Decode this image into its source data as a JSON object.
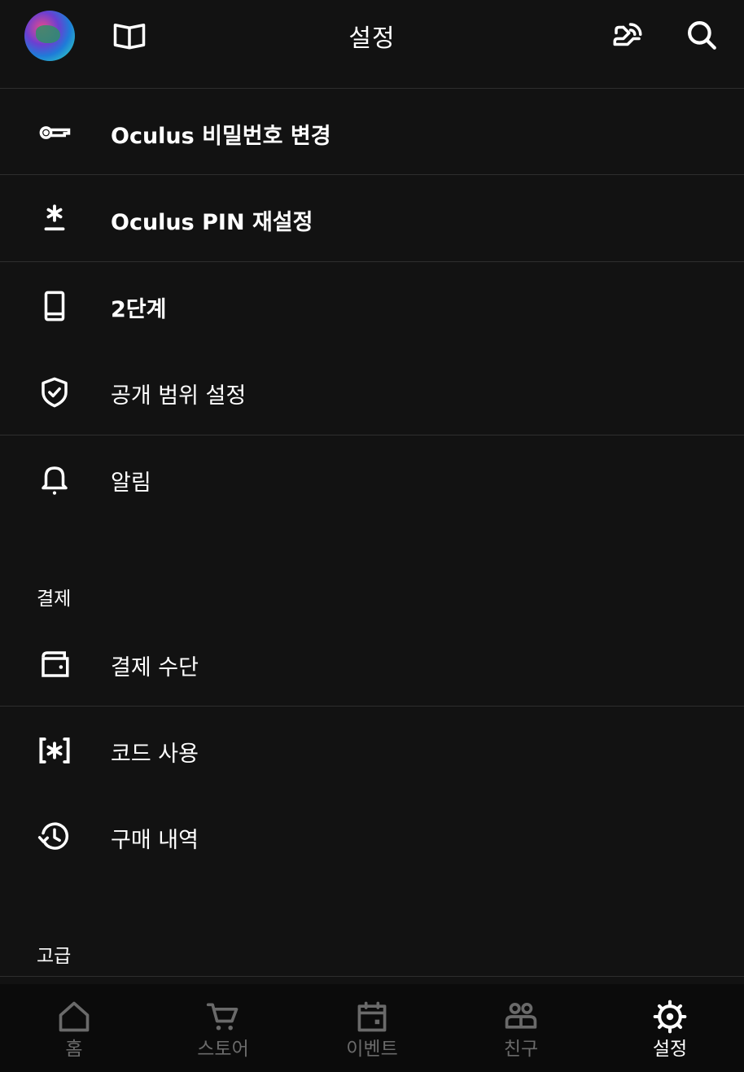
{
  "header": {
    "title": "설정",
    "avatar_icon": "user-avatar",
    "library_icon": "book-icon",
    "cast_icon": "cast-icon",
    "search_icon": "search-icon"
  },
  "rows": [
    {
      "label": "Oculus 비밀번호 변경",
      "icon": "key-icon"
    },
    {
      "label": "Oculus PIN 재설정",
      "icon": "asterisk-icon"
    },
    {
      "label": "2단계",
      "icon": "phone-icon"
    },
    {
      "label": "공개 범위 설정",
      "icon": "shield-check-icon"
    },
    {
      "label": "알림",
      "icon": "bell-icon"
    },
    {
      "label": "결제 수단",
      "icon": "wallet-icon"
    },
    {
      "label": "코드 사용",
      "icon": "bracket-asterisk-icon"
    },
    {
      "label": "구매 내역",
      "icon": "history-icon"
    }
  ],
  "sections": {
    "payment": "결제",
    "advanced": "고급"
  },
  "tabs": [
    {
      "label": "홈",
      "icon": "home-icon",
      "active": false
    },
    {
      "label": "스토어",
      "icon": "cart-icon",
      "active": false
    },
    {
      "label": "이벤트",
      "icon": "calendar-icon",
      "active": false
    },
    {
      "label": "친구",
      "icon": "friends-icon",
      "active": false
    },
    {
      "label": "설정",
      "icon": "gear-icon",
      "active": true
    }
  ],
  "colors": {
    "background": "#121212",
    "divider": "#2e2e2e",
    "tab_inactive": "#6a6a6a",
    "tab_active": "#ffffff"
  }
}
